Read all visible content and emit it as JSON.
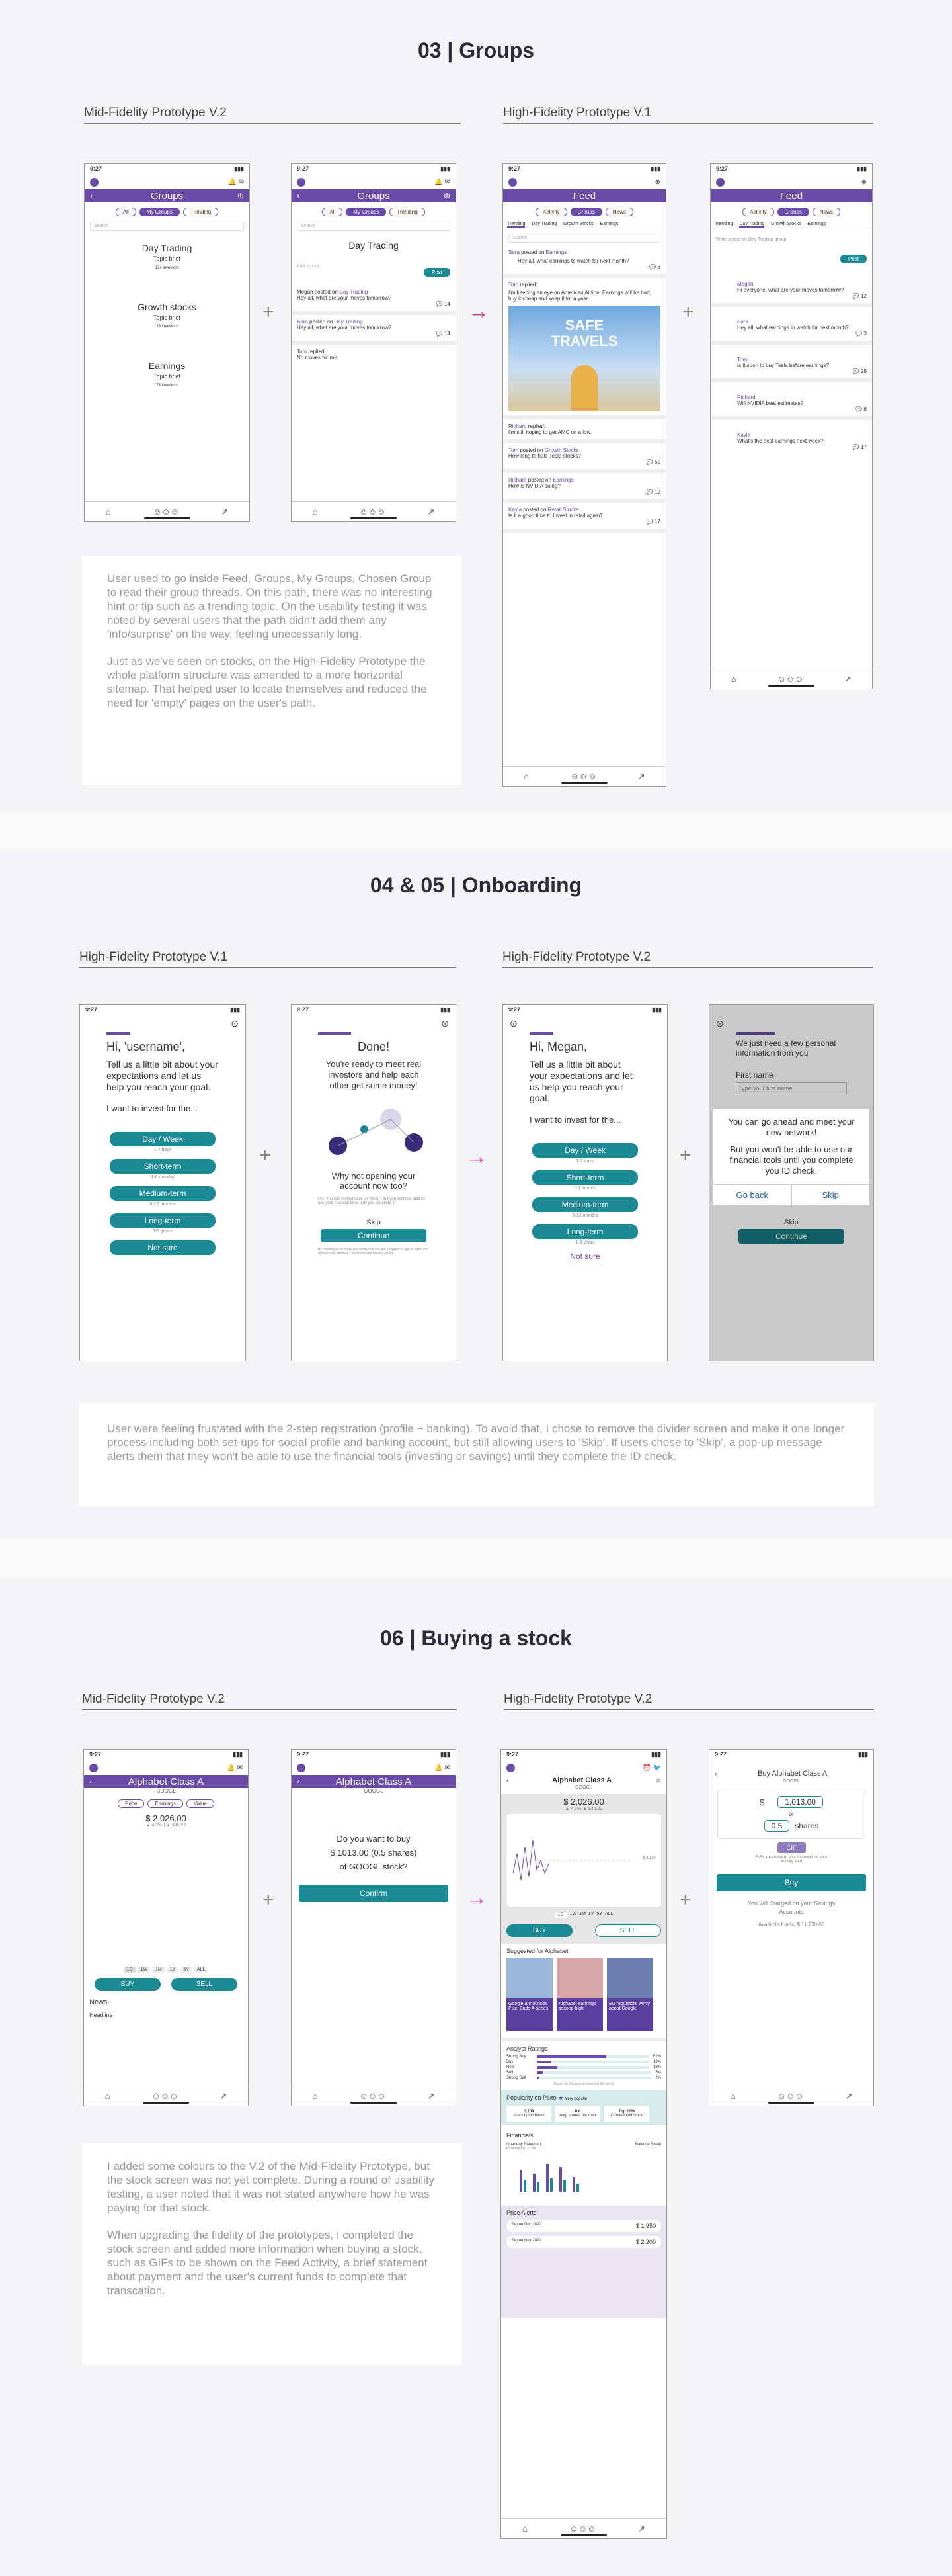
{
  "sections": {
    "groups": {
      "title": "03 | Groups",
      "left_label": "Mid-Fidelity Prototype V.2",
      "right_label": "High-Fidelity Prototype V.1",
      "note1": "User used to go inside Feed, Groups, My Groups, Chosen Group to read their group threads. On this path, there was no interesting hint or tip such as a trending topic. On the usability testing it was noted by several users that the path didn't add them any 'info/surprise' on the way, feeling unecessarily long.",
      "note2": "Just as we've seen on stocks, on the High-Fidelity Prototype the whole platform structure was amended to a more horizontal sitemap. That helped user to locate themselves and reduced the need for 'empty' pages on the user's path."
    },
    "onboarding": {
      "title": "04 & 05 | Onboarding",
      "left_label": "High-Fidelity Prototype V.1",
      "right_label": "High-Fidelity Prototype V.2",
      "note": "User were feeling frustated with the 2-step registration (profile + banking). To avoid that, I chose to remove the divider screen and make it one longer process including both set-ups for social profile and banking account, but still allowing users to 'Skip'. If users chose to 'Skip', a pop-up message alerts them that they won't be able to use the financial tools (investing or savings) until they complete the ID check."
    },
    "buying": {
      "title": "06 | Buying a stock",
      "left_label": "Mid-Fidelity Prototype V.2",
      "right_label": "High-Fidelity Prototype V.2",
      "note1": "I added some colours to the V.2 of the Mid-Fidelity Prototype, but the stock screen was not yet complete. During a round of usability testing, a user noted that it was not stated anywhere how he was paying for that stock.",
      "note2": "When upgrading the fidelity of the prototypes, I completed the stock screen and added more information when buying a stock, such as GIFs to be shown on the Feed Activity, a brief statement about payment and the user's current funds to complete that transcation."
    }
  },
  "common": {
    "time": "9:27",
    "search": "Search",
    "post": "Post"
  },
  "groups_a": {
    "header": "Groups",
    "tabs": [
      "All",
      "My Groups",
      "Trending"
    ],
    "items": [
      {
        "name": "Day Trading",
        "brief": "Topic brief",
        "count": "174 investors"
      },
      {
        "name": "Growth stocks",
        "brief": "Topic brief",
        "count": "36 investors"
      },
      {
        "name": "Earnings",
        "brief": "Topic brief",
        "count": "74 investors"
      }
    ]
  },
  "groups_b": {
    "header": "Groups",
    "tabs": [
      "All",
      "My Groups",
      "Trending"
    ],
    "title": "Day Trading",
    "add": "Add a post",
    "posts": [
      {
        "user": "Megan",
        "verb": "posted on",
        "group": "Day Trading",
        "text": "Hey all, what are your moves tomorrow?",
        "n": "14"
      },
      {
        "user": "Sara",
        "verb": "posted on",
        "group": "Day Trading",
        "text": "Hey all, what are your moves tomorrow?",
        "n": "14"
      },
      {
        "user": "Tom",
        "verb": "replied:",
        "group": "",
        "text": "No moves for me.",
        "n": ""
      }
    ]
  },
  "feed_a": {
    "header": "Feed",
    "tabs": [
      "Activity",
      "Groups",
      "News"
    ],
    "subtabs": [
      "Trending",
      "Day Trading",
      "Growth Stocks",
      "Earnings"
    ],
    "p1": {
      "user": "Sara",
      "group": "Earnings",
      "text": "Hey all, what earnings to watch for next month?",
      "n": "3"
    },
    "p2": {
      "user": "Tom",
      "text": "I'm keeping an eye on American Airline. Earnings will be bad, buy it cheap and keep it for a year.",
      "gif": "SAFE TRAVELS"
    },
    "p3": {
      "user": "Richard",
      "text": "I'm still hoping to get AMC on a low."
    },
    "p4": {
      "user": "Tom",
      "group": "Growth Stocks",
      "text": "How long to hold Tesla stocks?",
      "n": "55"
    },
    "p5": {
      "user": "Richard",
      "group": "Earnings",
      "text": "How is NVIDIA doing?",
      "n": "12"
    },
    "p6": {
      "user": "Kayla",
      "group": "Retail Stocks",
      "text": "Is it a good time to invest in retail again?",
      "n": "17"
    }
  },
  "feed_b": {
    "header": "Feed",
    "tabs": [
      "Activity",
      "Groups",
      "News"
    ],
    "subtabs": [
      "Trending",
      "Day Trading",
      "Growth Stocks",
      "Earnings"
    ],
    "write": "Write a post on Day Trading group",
    "posts": [
      {
        "user": "Megan",
        "text": "Hi everyone, what are your moves tomorrow?",
        "n": "12"
      },
      {
        "user": "Sara",
        "text": "Hey all, what earnings to watch for next month?",
        "n": "3"
      },
      {
        "user": "Tom",
        "text": "Is it soon to buy Tesla before earnings?",
        "n": "25"
      },
      {
        "user": "Richard",
        "text": "Will NVIDIA beat estimates?",
        "n": "8"
      },
      {
        "user": "Kayla",
        "text": "What's the best earnings next week?",
        "n": "17"
      }
    ]
  },
  "onb_a": {
    "greet": "Hi, 'username',",
    "intro": "Tell us a little bit about your expectations and let us help you reach your goal.",
    "q": "I want to invest for the...",
    "options": [
      {
        "l": "Day / Week",
        "s": "1-7 days"
      },
      {
        "l": "Short-term",
        "s": "1-6 months"
      },
      {
        "l": "Medium-term",
        "s": "6-12 months"
      },
      {
        "l": "Long-term",
        "s": "1-3 years"
      },
      {
        "l": "Not sure",
        "s": ""
      }
    ]
  },
  "onb_b": {
    "title": "Done!",
    "text": "You're ready to meet real investors and help each other get some money!",
    "ask": "Why not opening your account now too?",
    "fine": "P.S. You can do that later on 'Menu'. But you won't be able to use your financial tools until you complete it.",
    "skip": "Skip",
    "cont": "Continue",
    "legal": "By creating an account you certify that you are 18 years of age or older and agree to our Terms & Conditions and Privacy Policy"
  },
  "onb_c": {
    "greet": "Hi, Megan,",
    "intro": "Tell us a little bit about your expectations and let us help you reach your goal.",
    "q": "I want to invest for the...",
    "options": [
      {
        "l": "Day / Week",
        "s": "1-7 days"
      },
      {
        "l": "Short-term",
        "s": "1-6 months"
      },
      {
        "l": "Medium-term",
        "s": "6-12 months"
      },
      {
        "l": "Long-term",
        "s": "1-3 years"
      }
    ],
    "notsure": "Not sure"
  },
  "onb_d": {
    "title": "We just need a few personal information from you",
    "label": "First name",
    "placeholder": "Type your first name",
    "m1": "You can go ahead and meet your new network!",
    "m2": "But you won't be able to use our financial tools until you complete you ID check.",
    "back": "Go back",
    "skip": "Skip",
    "skip2": "Skip",
    "cont": "Continue"
  },
  "stock_a": {
    "header": "Alphabet Class A",
    "ticker": "GOOGL",
    "tabs": [
      "Price",
      "Earnings",
      "Value"
    ],
    "price": "$ 2,026.00",
    "change": "▲ 4.7% | ▲ $45.22",
    "ranges": [
      "1D",
      "1W",
      "1M",
      "1Y",
      "5Y",
      "ALL"
    ],
    "buy": "BUY",
    "sell": "SELL",
    "news": "News",
    "headline": "Headline"
  },
  "stock_b": {
    "header": "Alphabet Class A",
    "ticker": "GOOGL",
    "q1": "Do you want to buy",
    "q2": "$ 1013.00 (0.5 shares)",
    "q3": "of GOOGL stock?",
    "confirm": "Confirm"
  },
  "stock_c": {
    "name": "Alphabet Class A",
    "ticker": "GOOGL",
    "price": "$ 2,026.00",
    "change": "▲ 4.7%  ▲ $45.22",
    "last": "$ 2,134",
    "ranges": [
      "1D",
      "1W",
      "1M",
      "1Y",
      "5Y",
      "ALL"
    ],
    "buy": "BUY",
    "sell": "SELL",
    "suggested": "Suggested for Alphabet",
    "cards": [
      "Google announces Pixel Buds A-series",
      "Alphabet earnings second high",
      "EU regulators worry about Google"
    ],
    "analyst": "Analyst Ratings",
    "ratings": [
      {
        "l": "Strong Buy",
        "p": "62%",
        "v": 0.62
      },
      {
        "l": "Buy",
        "p": "13%",
        "v": 0.13
      },
      {
        "l": "Hold",
        "p": "18%",
        "v": 0.18
      },
      {
        "l": "Sell",
        "p": "5%",
        "v": 0.05
      },
      {
        "l": "Strong Sell",
        "p": "2%",
        "v": 0.02
      }
    ],
    "ratings_note": "Based on 53 analysts covering this stock",
    "pop": "Popularity on Pluto",
    "verypop": "Very popular",
    "stats": [
      {
        "v": "3,709",
        "l": "users hold shares"
      },
      {
        "v": "0.8",
        "l": "Avg. shares per user"
      },
      {
        "v": "Top 10%",
        "l": "Commented stock"
      }
    ],
    "financials": "Financials",
    "fin1": "Quarterly Statement",
    "fin1b": "Profit margin: 22.8%",
    "fin2": "Balance Sheet",
    "alerts": "Price Alerts",
    "a1": {
      "l": "Set on Dec 2020",
      "v": "$ 1,950"
    },
    "a2": {
      "l": "Set on Nov 2021",
      "v": "$ 2,200"
    }
  },
  "stock_d": {
    "header": "Buy Alphabet Class A",
    "ticker": "GOOGL",
    "usd": "1,013.00",
    "or": "or",
    "shares": "0.5",
    "shares_l": "shares",
    "gif": "GIF",
    "gifnote": "GIFs are visible to your followers on your Activity feed",
    "buy": "Buy",
    "charged": "You will charged on your Savings Accounts",
    "funds": "Available funds: $ 11,230.00"
  },
  "colors": {
    "purple": "#6a4ba8",
    "teal": "#1a8a94",
    "pink": "#e0309a"
  }
}
